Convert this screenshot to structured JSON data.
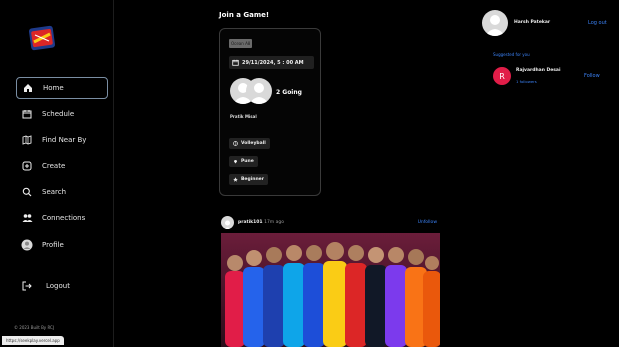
{
  "sidebar": {
    "items": [
      {
        "label": "Home",
        "icon": "home-icon",
        "active": true
      },
      {
        "label": "Schedule",
        "icon": "calendar-icon"
      },
      {
        "label": "Find Near By",
        "icon": "map-icon"
      },
      {
        "label": "Create",
        "icon": "plus-square-icon"
      },
      {
        "label": "Search",
        "icon": "search-icon"
      },
      {
        "label": "Connections",
        "icon": "users-icon"
      },
      {
        "label": "Profile",
        "icon": "user-circle-icon"
      }
    ],
    "logout": "Logout",
    "copyright": "© 2023 Built By RCJ",
    "status_url": "https://seekplay.vercel.app"
  },
  "main": {
    "join_title": "Join a Game!",
    "game": {
      "tag": "Ocean A8",
      "datetime": "29/11/2024, 5 : 00 AM",
      "going": "2 Going",
      "organizer": "Pratik Misal",
      "sport": "Volleyball",
      "location": "Pune",
      "level": "Beginner"
    },
    "post": {
      "user": "pratik101",
      "time": "• 17m ago",
      "action": "Unfollow"
    }
  },
  "right": {
    "profile_name": "Harsh Patekar",
    "logout": "Log out",
    "suggested_title": "Suggested for you",
    "suggestion": {
      "initial": "R",
      "name": "Rajvardhan Desai",
      "followers": "1 followers",
      "action": "Follow"
    }
  },
  "colors": {
    "accent": "#3b82f6",
    "suggestion_avatar": "#e11d48",
    "background": "#000000"
  }
}
